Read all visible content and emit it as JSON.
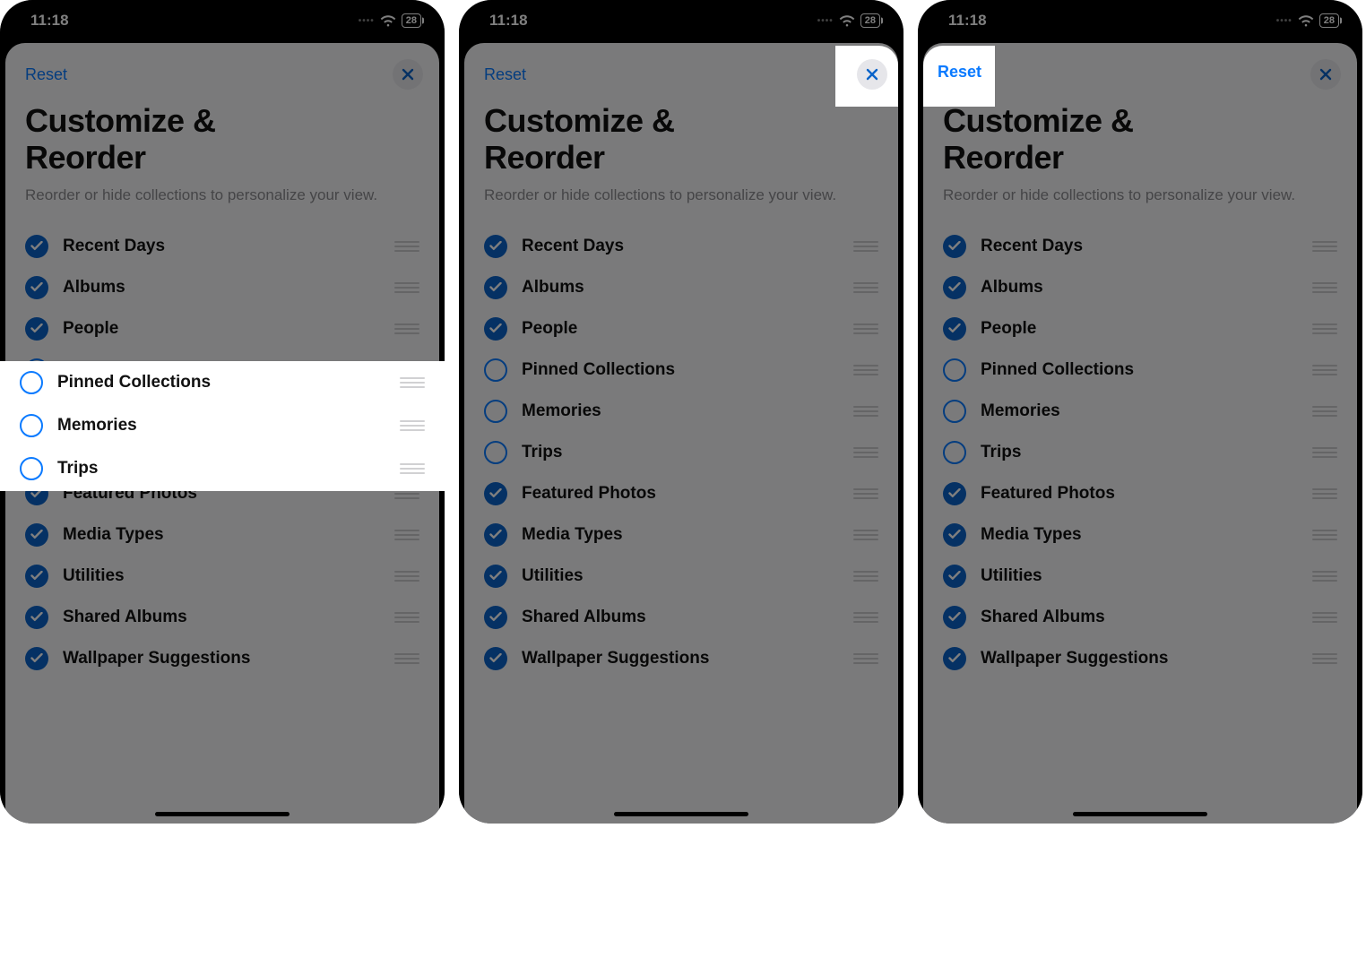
{
  "status": {
    "time": "11:18",
    "battery": "28"
  },
  "sheet": {
    "reset_label": "Reset",
    "title_line1": "Customize &",
    "title_line2": "Reorder",
    "subtitle": "Reorder or hide collections to personalize your view."
  },
  "items": [
    {
      "label": "Recent Days",
      "checked": true
    },
    {
      "label": "Albums",
      "checked": true
    },
    {
      "label": "People",
      "checked": true
    },
    {
      "label": "Pinned Collections",
      "checked": false
    },
    {
      "label": "Memories",
      "checked": false
    },
    {
      "label": "Trips",
      "checked": false
    },
    {
      "label": "Featured Photos",
      "checked": true
    },
    {
      "label": "Media Types",
      "checked": true
    },
    {
      "label": "Utilities",
      "checked": true
    },
    {
      "label": "Shared Albums",
      "checked": true
    },
    {
      "label": "Wallpaper Suggestions",
      "checked": true
    }
  ],
  "panels": [
    {
      "highlight": "rows-unchecked"
    },
    {
      "highlight": "close-button"
    },
    {
      "highlight": "reset-button"
    }
  ]
}
